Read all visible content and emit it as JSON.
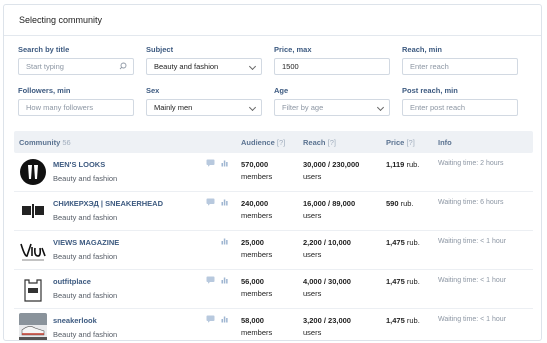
{
  "header": {
    "title": "Selecting community"
  },
  "filters": {
    "search_by_title": {
      "label": "Search by title",
      "placeholder": "Start typing"
    },
    "subject": {
      "label": "Subject",
      "value": "Beauty and fashion"
    },
    "price_max": {
      "label": "Price, max",
      "value": "1500"
    },
    "reach_min": {
      "label": "Reach, min",
      "placeholder": "Enter reach"
    },
    "followers_min": {
      "label": "Followers, min",
      "placeholder": "How many followers"
    },
    "sex": {
      "label": "Sex",
      "value": "Mainly men"
    },
    "age": {
      "label": "Age",
      "placeholder": "Filter by age"
    },
    "post_reach_min": {
      "label": "Post reach, min",
      "placeholder": "Enter post reach"
    }
  },
  "table": {
    "headers": {
      "community": "Community",
      "community_count": "56",
      "audience": "Audience",
      "audience_q": "[?]",
      "reach": "Reach",
      "reach_q": "[?]",
      "price": "Price",
      "price_q": "[?]",
      "info": "Info"
    },
    "rows": [
      {
        "name": "MEN'S LOOKS",
        "category": "Beauty and fashion",
        "has_msg": true,
        "audience": "570,000",
        "audience_unit": "members",
        "reach": "30,000 / 230,000",
        "reach_unit": "users",
        "price": "1,119",
        "price_unit": "rub.",
        "info": "Waiting time: 2 hours"
      },
      {
        "name": "СНИКЕРХЭД | SNEAKERHEAD",
        "category": "Beauty and fashion",
        "has_msg": true,
        "audience": "240,000",
        "audience_unit": "members",
        "reach": "16,000 / 89,000",
        "reach_unit": "users",
        "price": "590",
        "price_unit": "rub.",
        "info": "Waiting time: 6 hours"
      },
      {
        "name": "VIEWS MAGAZINE",
        "category": "Beauty and fashion",
        "has_msg": false,
        "audience": "25,000",
        "audience_unit": "members",
        "reach": "2,200 / 10,000",
        "reach_unit": "users",
        "price": "1,475",
        "price_unit": "rub.",
        "info": "Waiting time: < 1 hour"
      },
      {
        "name": "outfitplace",
        "category": "Beauty and fashion",
        "has_msg": true,
        "audience": "56,000",
        "audience_unit": "members",
        "reach": "4,000 / 30,000",
        "reach_unit": "users",
        "price": "1,475",
        "price_unit": "rub.",
        "info": "Waiting time: < 1 hour"
      },
      {
        "name": "sneakerlook",
        "category": "Beauty and fashion",
        "has_msg": true,
        "audience": "58,000",
        "audience_unit": "members",
        "reach": "3,200 / 23,000",
        "reach_unit": "users",
        "price": "1,475",
        "price_unit": "rub.",
        "info": "Waiting time: < 1 hour"
      }
    ]
  },
  "icons": {
    "message": "message-icon",
    "stats": "stats-icon",
    "search": "search-icon",
    "chevron": "chevron-down-icon"
  },
  "colors": {
    "label_blue": "#3d5a80",
    "icon_blue": "#b8c9de",
    "muted": "#8c96a3"
  }
}
